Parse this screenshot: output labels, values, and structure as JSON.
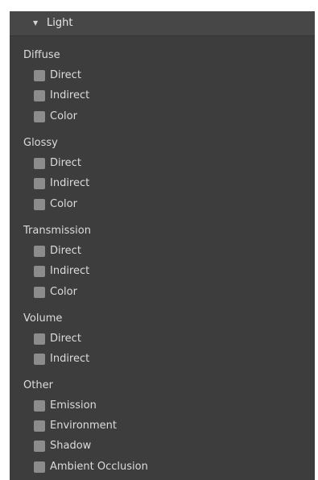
{
  "panel": {
    "title": "Light",
    "sections": [
      {
        "label": "Diffuse",
        "options": [
          {
            "label": "Direct",
            "checked": false
          },
          {
            "label": "Indirect",
            "checked": false
          },
          {
            "label": "Color",
            "checked": false
          }
        ]
      },
      {
        "label": "Glossy",
        "options": [
          {
            "label": "Direct",
            "checked": false
          },
          {
            "label": "Indirect",
            "checked": false
          },
          {
            "label": "Color",
            "checked": false
          }
        ]
      },
      {
        "label": "Transmission",
        "options": [
          {
            "label": "Direct",
            "checked": false
          },
          {
            "label": "Indirect",
            "checked": false
          },
          {
            "label": "Color",
            "checked": false
          }
        ]
      },
      {
        "label": "Volume",
        "options": [
          {
            "label": "Direct",
            "checked": false
          },
          {
            "label": "Indirect",
            "checked": false
          }
        ]
      },
      {
        "label": "Other",
        "options": [
          {
            "label": "Emission",
            "checked": false
          },
          {
            "label": "Environment",
            "checked": false
          },
          {
            "label": "Shadow",
            "checked": false
          },
          {
            "label": "Ambient Occlusion",
            "checked": false
          }
        ]
      }
    ]
  },
  "colors": {
    "panel_bg": "#3d3d3d",
    "header_bg": "#474747",
    "checkbox": "#8c8c8c",
    "text": "#dcdcdc"
  },
  "icons": {
    "collapse": "disclosure-triangle-down"
  }
}
